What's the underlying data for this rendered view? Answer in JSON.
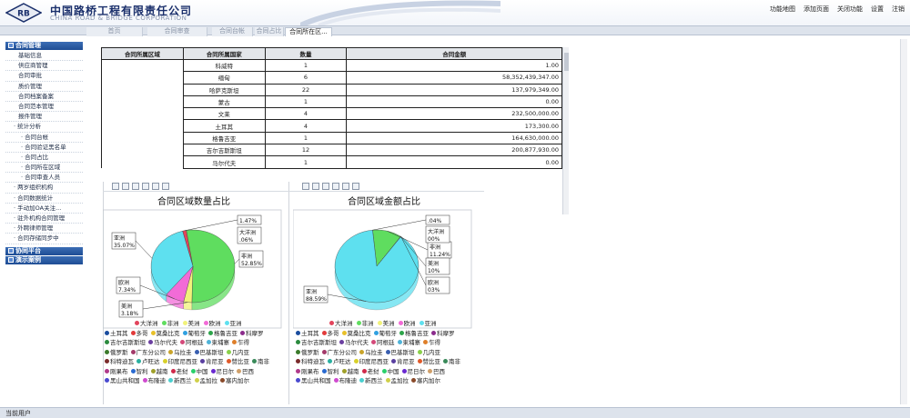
{
  "header": {
    "company_cn": "中国路桥工程有限责任公司",
    "company_en": "CHINA ROAD & BRIDGE CORPORATION",
    "logo_text": "RB",
    "links": [
      "功能地图",
      "添加页面",
      "关闭功能",
      "设置",
      "注销"
    ]
  },
  "tabs": [
    "首页",
    "合同审查",
    "合同台帐",
    "合同占比",
    "合同所在区..."
  ],
  "active_tab": 4,
  "sidebar": {
    "sections": [
      {
        "label": "合同管理",
        "expanded": true
      },
      {
        "label": "协同平台",
        "expanded": false
      },
      {
        "label": "演示案例",
        "expanded": false
      }
    ],
    "items": [
      {
        "label": "基础信息",
        "level": 1
      },
      {
        "label": "供应商管理",
        "level": 1
      },
      {
        "label": "合同审批",
        "level": 1
      },
      {
        "label": "质价管理",
        "level": 1
      },
      {
        "label": "合同档案备案",
        "level": 1
      },
      {
        "label": "合同范本管理",
        "level": 1
      },
      {
        "label": "报件管理",
        "level": 1
      },
      {
        "label": "统计分析",
        "level": 0
      },
      {
        "label": "合同台帐",
        "level": 2
      },
      {
        "label": "合同验证黑名单",
        "level": 2
      },
      {
        "label": "合同占比",
        "level": 2
      },
      {
        "label": "合同所在区域",
        "level": 2
      },
      {
        "label": "合同审查人员",
        "level": 2
      },
      {
        "label": "两岁组织机构",
        "level": 0
      },
      {
        "label": "合同数据统计",
        "level": 0
      },
      {
        "label": "手动加OA关注...",
        "level": 0
      },
      {
        "label": "驻外机构合同管理",
        "level": 0
      },
      {
        "label": "外聘律师管理",
        "level": 0
      },
      {
        "label": "合同存储同步中",
        "level": 0
      }
    ]
  },
  "table": {
    "headers": [
      "合同所属区域",
      "合同所属国家",
      "数量",
      "合同金额"
    ],
    "rows": [
      [
        "科威特",
        "1",
        "1.00"
      ],
      [
        "缅甸",
        "6",
        "58,352,439,347.00"
      ],
      [
        "哈萨克斯坦",
        "22",
        "137,979,349.00"
      ],
      [
        "蒙古",
        "1",
        "0.00"
      ],
      [
        "文莱",
        "4",
        "232,500,000.00"
      ],
      [
        "土耳其",
        "4",
        "173,300.00"
      ],
      [
        "格鲁吉亚",
        "1",
        "164,630,000.00"
      ],
      [
        "吉尔吉斯斯坦",
        "12",
        "200,877,930.00"
      ],
      [
        "马尔代夫",
        "1",
        "0.00"
      ]
    ]
  },
  "chart_data": [
    {
      "type": "pie",
      "title": "合同区域数量占比",
      "categories": [
        "大洋洲",
        "非洲",
        "美洲",
        "欧洲",
        "亚洲"
      ],
      "values": [
        1.47,
        52.85,
        3.18,
        7.34,
        35.07
      ],
      "labels": [
        "1.47%",
        "非洲 52.85%",
        "美洲 3.18%",
        "欧洲 7.34%",
        "亚洲 35.07%"
      ],
      "extra_label": "大洋洲 .06%",
      "colors": [
        "#e2445c",
        "#5fdd5f",
        "#f1f27a",
        "#f26bd7",
        "#5ee0ef"
      ]
    },
    {
      "type": "pie",
      "title": "合同区域金额占比",
      "categories": [
        "大洋洲",
        "非洲",
        "美洲",
        "欧洲",
        "亚洲"
      ],
      "values": [
        0.04,
        11.24,
        0.1,
        0.03,
        88.59
      ],
      "labels": [
        ".04%",
        "非洲 11.24%",
        "美洲 10%",
        "欧洲 03%",
        "亚洲 88.59%"
      ],
      "extra_label": "大洋洲 00%",
      "colors": [
        "#e2445c",
        "#5fdd5f",
        "#f1f27a",
        "#f26bd7",
        "#5ee0ef"
      ]
    }
  ],
  "country_legend": [
    [
      {
        "n": "土耳其",
        "c": "#1a4d9e"
      },
      {
        "n": "多哥",
        "c": "#e23b3b"
      },
      {
        "n": "莫桑比克",
        "c": "#e8c02a"
      },
      {
        "n": "葡萄牙",
        "c": "#30a0e0"
      },
      {
        "n": "格鲁吉亚",
        "c": "#2da44a"
      },
      {
        "n": "科摩罗",
        "c": "#8b2c8c"
      }
    ],
    [
      {
        "n": "吉尔吉斯斯坦",
        "c": "#2b8a3e"
      },
      {
        "n": "马尔代夫",
        "c": "#6b3fa0"
      },
      {
        "n": "阿根廷",
        "c": "#d44a7a"
      },
      {
        "n": "柬埔寨",
        "c": "#4fb3d8"
      },
      {
        "n": "乍得",
        "c": "#de7f2a"
      }
    ],
    [
      {
        "n": "俄罗斯",
        "c": "#3b7a2b"
      },
      {
        "n": "广东分公司",
        "c": "#a33a6a"
      },
      {
        "n": "乌拉圭",
        "c": "#c9a42a"
      },
      {
        "n": "巴基斯坦",
        "c": "#3a5fb0"
      },
      {
        "n": "几内亚",
        "c": "#8ad04a"
      }
    ],
    [
      {
        "n": "科特迪瓦",
        "c": "#7a2b2b"
      },
      {
        "n": "卢旺达",
        "c": "#2ab0a0"
      },
      {
        "n": "印度尼西亚",
        "c": "#d8d02a"
      },
      {
        "n": "肯尼亚",
        "c": "#5a3fa0"
      },
      {
        "n": "赞比亚",
        "c": "#e05a2a"
      },
      {
        "n": "南非",
        "c": "#3a8a5a"
      }
    ],
    [
      {
        "n": "刚果布",
        "c": "#b03a8a"
      },
      {
        "n": "智利",
        "c": "#2a6ad0"
      },
      {
        "n": "越南",
        "c": "#a0a02a"
      },
      {
        "n": "老挝",
        "c": "#d02a4a"
      },
      {
        "n": "中国",
        "c": "#2ad06a"
      },
      {
        "n": "尼日尔",
        "c": "#6a2ad0"
      },
      {
        "n": "巴西",
        "c": "#d0a06a"
      }
    ],
    [
      {
        "n": "黑山共和国",
        "c": "#4a4ad0"
      },
      {
        "n": "布隆迪",
        "c": "#d04ad0"
      },
      {
        "n": "新西兰",
        "c": "#4ad0d0"
      },
      {
        "n": "孟加拉",
        "c": "#d0d04a"
      },
      {
        "n": "塞内加尔",
        "c": "#8a4a2a"
      }
    ]
  ],
  "status_bar": "当前用户"
}
